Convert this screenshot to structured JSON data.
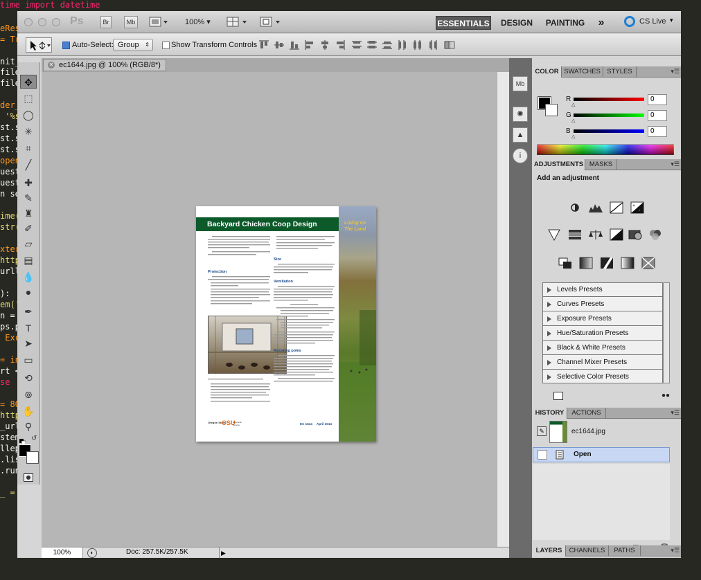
{
  "editor": {
    "lines": [
      "time import datetime",
      "eRes",
      "= Tr",
      "",
      "nit_",
      "file",
      "file",
      "",
      "der_",
      " '%s",
      "st.s",
      "st.s",
      "st.s",
      "open",
      "uest",
      "uest",
      "n se",
      "",
      "ime(",
      "str(",
      "",
      "xter",
      "http",
      "urll",
      "",
      "):",
      "em('",
      "n =",
      "ps.p",
      " Exc",
      "",
      "= in",
      "rt <",
      "se",
      "",
      "= 80",
      "http",
      "_url",
      "stem",
      "llep",
      ".lis",
      ".run",
      "",
      "_ ="
    ]
  },
  "appbar": {
    "logo": "Ps",
    "bridge_label": "Br",
    "mini_bridge_label": "Mb",
    "zoom_level": "100%",
    "workspaces": [
      "ESSENTIALS",
      "DESIGN",
      "PAINTING"
    ],
    "more_label": "»",
    "cs_live_label": "CS Live"
  },
  "options": {
    "auto_select_label": "Auto-Select:",
    "auto_select_value": "Group",
    "show_transform_label": "Show Transform Controls"
  },
  "document": {
    "tab_title": "ec1644.jpg @ 100% (RGB/8*)",
    "status_zoom": "100%",
    "status_doc": "Doc: 257.5K/257.5K"
  },
  "page": {
    "title": "Backyard Chicken Coop Design",
    "strip_text_1": "Living on",
    "strip_text_2": "The Land",
    "sections": [
      "Protection",
      "Size",
      "Ventilation",
      "Roosting poles"
    ],
    "footer_code": "EC 1644",
    "footer_date": "April 2014",
    "logo_text": "Oregon State",
    "logo_osu": "OSU",
    "logo_ext": "Extension Service"
  },
  "color_panel": {
    "tabs": [
      "COLOR",
      "SWATCHES",
      "STYLES"
    ],
    "channels": [
      {
        "label": "R",
        "value": "0",
        "color": "#d00000"
      },
      {
        "label": "G",
        "value": "0",
        "color": "#00b000"
      },
      {
        "label": "B",
        "value": "0",
        "color": "#0000c0"
      }
    ]
  },
  "adjustments_panel": {
    "tabs": [
      "ADJUSTMENTS",
      "MASKS"
    ],
    "title": "Add an adjustment",
    "presets": [
      "Levels Presets",
      "Curves Presets",
      "Exposure Presets",
      "Hue/Saturation Presets",
      "Black & White Presets",
      "Channel Mixer Presets",
      "Selective Color Presets"
    ]
  },
  "history_panel": {
    "tabs": [
      "HISTORY",
      "ACTIONS"
    ],
    "snapshot_label": "ec1644.jpg",
    "steps": [
      "Open"
    ]
  },
  "layers_panel": {
    "tabs": [
      "LAYERS",
      "CHANNELS",
      "PATHS"
    ]
  }
}
